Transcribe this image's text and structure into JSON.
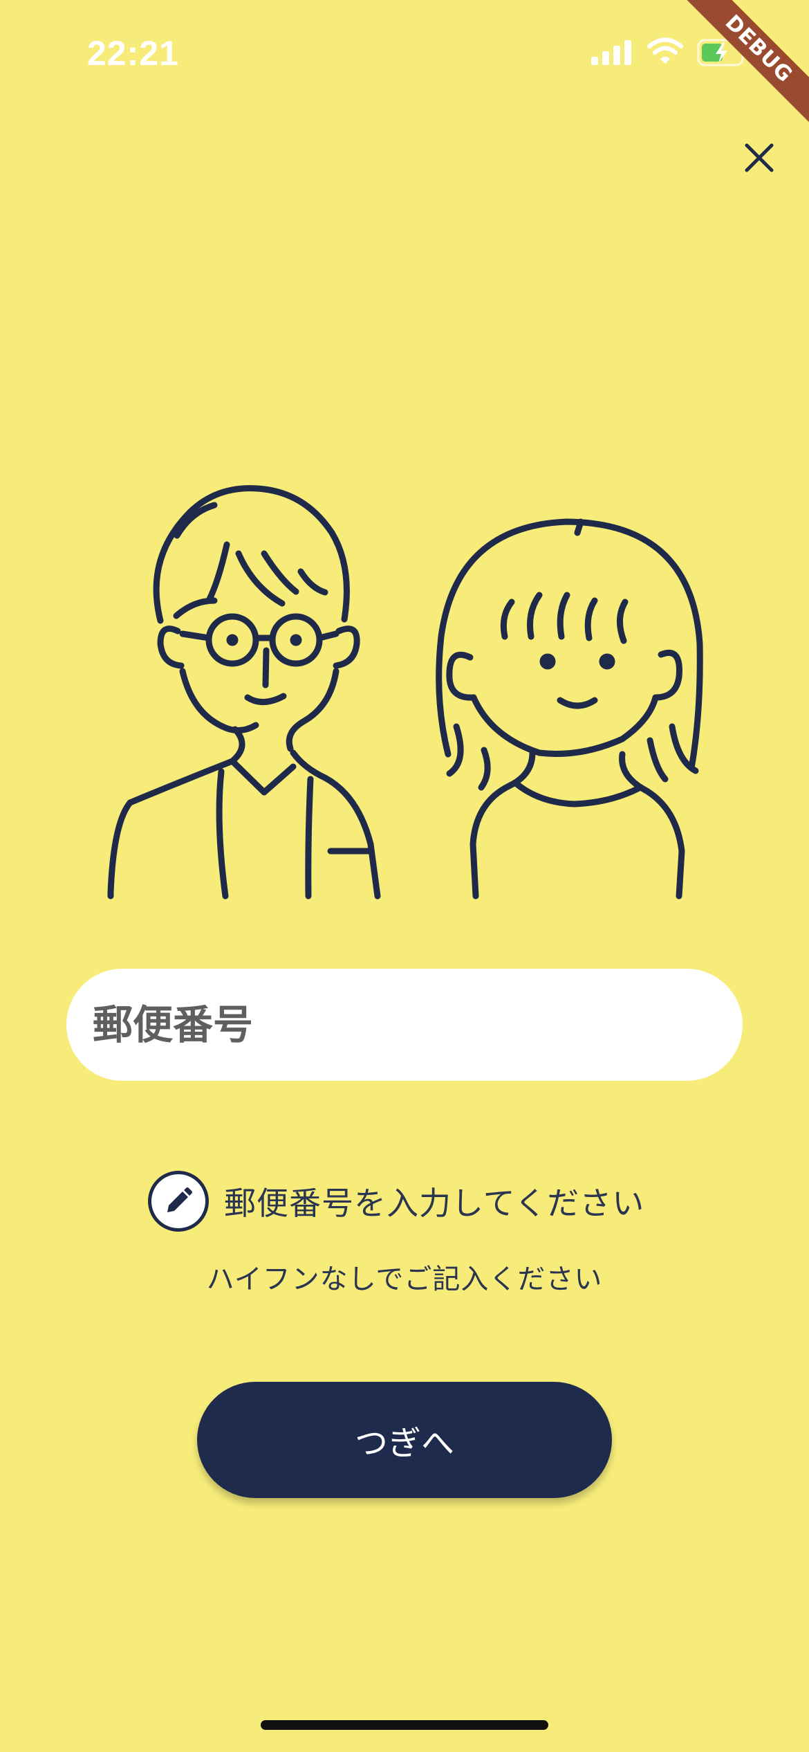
{
  "status_bar": {
    "time": "22:21"
  },
  "debug_banner": {
    "label": "DEBUG",
    "color": "#9A4A2F"
  },
  "close_icon": "close-icon",
  "postal_code_input": {
    "placeholder": "郵便番号",
    "value": ""
  },
  "hint": {
    "icon": "pencil-icon",
    "main": "郵便番号を入力してください",
    "sub": "ハイフンなしでご記入ください"
  },
  "next_button": {
    "label": "つぎへ"
  },
  "colors": {
    "background": "#F7EC7A",
    "accent": "#1F2B4D",
    "input_background": "#FFFFFF"
  }
}
